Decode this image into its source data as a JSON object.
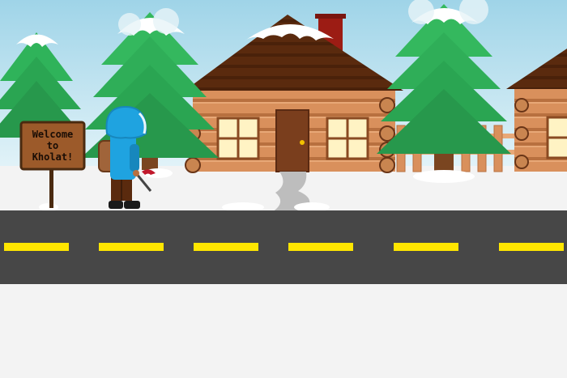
{
  "sign": {
    "line1": "Welcome",
    "line2": "to",
    "line3": "Kholat!"
  },
  "palette": {
    "sky_top": "#a8d8ea",
    "sky_bottom": "#e6f4f8",
    "snow": "#f2f2f2",
    "road": "#474747",
    "road_line": "#ffe600",
    "log": "#d9905c",
    "roof": "#5a2a0e",
    "tree": "#2fb35a",
    "jacket": "#1fa3e0",
    "door": "#7a3e1d",
    "chimney": "#9c1c14"
  },
  "icons": [
    "pine-tree-icon",
    "log-cabin-icon",
    "hiker-character-icon",
    "ice-axe-icon",
    "welcome-sign-icon"
  ]
}
